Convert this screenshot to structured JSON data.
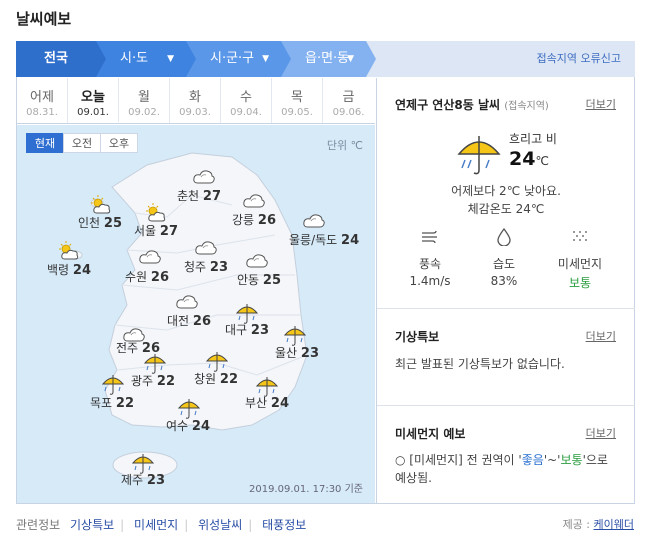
{
  "page_title": "날씨예보",
  "nav": {
    "all": "전국",
    "sido": "시·도",
    "sigungu": "시·군·구",
    "dong": "읍·면·동",
    "report": "접속지역 오류신고"
  },
  "days": [
    {
      "name": "어제",
      "date": "08.31."
    },
    {
      "name": "오늘",
      "date": "09.01."
    },
    {
      "name": "월",
      "date": "09.02."
    },
    {
      "name": "화",
      "date": "09.03."
    },
    {
      "name": "수",
      "date": "09.04."
    },
    {
      "name": "목",
      "date": "09.05."
    },
    {
      "name": "금",
      "date": "09.06."
    }
  ],
  "map": {
    "modes": [
      "현재",
      "오전",
      "오후"
    ],
    "unit": "단위 ℃",
    "base_time": "2019.09.01. 17:30 기준",
    "cities": [
      {
        "name": "춘천",
        "temp": "27",
        "icon": "cloud-icon"
      },
      {
        "name": "인천",
        "temp": "25",
        "icon": "partly-sunny-icon"
      },
      {
        "name": "서울",
        "temp": "27",
        "icon": "partly-sunny-icon"
      },
      {
        "name": "강릉",
        "temp": "26",
        "icon": "cloud-icon"
      },
      {
        "name": "울릉/독도",
        "temp": "24",
        "icon": "cloud-icon"
      },
      {
        "name": "백령",
        "temp": "24",
        "icon": "partly-sunny-icon"
      },
      {
        "name": "수원",
        "temp": "26",
        "icon": "cloud-icon"
      },
      {
        "name": "청주",
        "temp": "23",
        "icon": "cloud-icon"
      },
      {
        "name": "안동",
        "temp": "25",
        "icon": "cloud-icon"
      },
      {
        "name": "대전",
        "temp": "26",
        "icon": "cloud-icon"
      },
      {
        "name": "대구",
        "temp": "23",
        "icon": "umbrella-icon"
      },
      {
        "name": "전주",
        "temp": "26",
        "icon": "cloud-icon"
      },
      {
        "name": "울산",
        "temp": "23",
        "icon": "umbrella-icon"
      },
      {
        "name": "광주",
        "temp": "22",
        "icon": "umbrella-icon"
      },
      {
        "name": "창원",
        "temp": "22",
        "icon": "umbrella-icon"
      },
      {
        "name": "목포",
        "temp": "22",
        "icon": "umbrella-icon"
      },
      {
        "name": "부산",
        "temp": "24",
        "icon": "umbrella-icon"
      },
      {
        "name": "여수",
        "temp": "24",
        "icon": "umbrella-icon"
      },
      {
        "name": "제주",
        "temp": "23",
        "icon": "umbrella-icon"
      }
    ]
  },
  "local": {
    "title": "연제구 연산8동 날씨",
    "subtitle": "(접속지역)",
    "more": "더보기",
    "condition": "흐리고 비",
    "temp": "24",
    "temp_unit": "℃",
    "compare": "어제보다 2℃ 낮아요.",
    "feels": "체감온도 24℃",
    "stats": [
      {
        "label": "풍속",
        "value": "1.4m/s",
        "icon": "wind-icon"
      },
      {
        "label": "습도",
        "value": "83%",
        "icon": "humidity-drop-icon"
      },
      {
        "label": "미세먼지",
        "value": "보통",
        "icon": "fine-dust-icon"
      }
    ]
  },
  "alert": {
    "title": "기상특보",
    "more": "더보기",
    "text": "최근 발표된 기상특보가 없습니다."
  },
  "dust": {
    "title": "미세먼지 예보",
    "more": "더보기",
    "line1_pre": "○ [미세먼지] 전 권역이 '",
    "good": "좋음",
    "mid": "'~'",
    "normal": "보통",
    "line1_post": "'으로",
    "line2": "예상됨."
  },
  "related": {
    "label": "관련정보",
    "links": [
      "기상특보",
      "미세먼지",
      "위성날씨",
      "태풍정보"
    ]
  },
  "provider": {
    "label": "제공 :",
    "name": "케이웨더"
  },
  "colors": {
    "nav_dark": "#2f6fcc",
    "map_sea": "#d6eaf8",
    "land": "#f4f6f9",
    "umbrella": "#f5c518",
    "good_green": "#2a9d3e"
  }
}
